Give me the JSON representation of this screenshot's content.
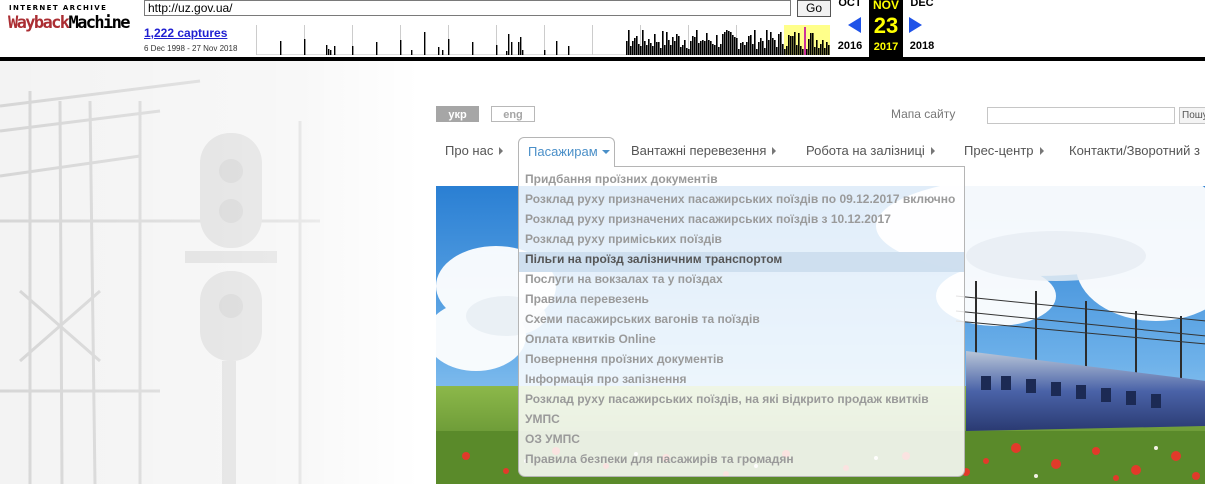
{
  "wayback": {
    "logo_top": "INTERNET ARCHIVE",
    "logo_way": "Wayback",
    "logo_machine": "Machine",
    "url": "http://uz.gov.ua/",
    "go_label": "Go",
    "captures": "1,222 captures",
    "range": "6 Dec 1998 - 27 Nov 2018",
    "prev_month": "OCT",
    "cur_month": "NOV",
    "next_month": "DEC",
    "cur_day": "23",
    "prev_year": "2016",
    "cur_year": "2017",
    "next_year": "2018",
    "colors": {
      "highlight": "#ffff00",
      "arrow": "#1f53e8",
      "logo_red": "#ab2e33"
    }
  },
  "header": {
    "lang_ukr": "укр",
    "lang_eng": "eng",
    "sitemap": "Мапа сайту",
    "search_button": "Пошук"
  },
  "nav": {
    "items": [
      {
        "label": "Про нас"
      },
      {
        "label": "Пасажирам"
      },
      {
        "label": "Вантажні перевезення"
      },
      {
        "label": "Робота на залізниці"
      },
      {
        "label": "Прес-центр"
      },
      {
        "label": "Контакти/Зворотний з"
      }
    ]
  },
  "dropdown": {
    "items": [
      {
        "label": "Придбання проїзних документів"
      },
      {
        "label": "Розклад руху призначених пасажирських поїздів по 09.12.2017 включно"
      },
      {
        "label": "Розклад руху призначених пасажирських поїздів з 10.12.2017"
      },
      {
        "label": "Розклад руху приміських поїздів"
      },
      {
        "label": "Пільги на проїзд залізничним транспортом"
      },
      {
        "label": "Послуги на вокзалах та у поїздах"
      },
      {
        "label": "Правила перевезень"
      },
      {
        "label": "Схеми пасажирських вагонів та поїздів"
      },
      {
        "label": "Оплата квитків Online"
      },
      {
        "label": "Повернення проїзних документів"
      },
      {
        "label": "Інформація про запізнення"
      },
      {
        "label": "Розклад руху пасажирських поїздів, на які відкрито продаж квитків"
      },
      {
        "label": "УМПС"
      },
      {
        "label": "ОЗ УМПС"
      },
      {
        "label": "Правила безпеки для пасажирів та громадян"
      }
    ]
  },
  "colors": {
    "nav_active": "#4a8fc8",
    "dropdown_highlight": "#ccddee"
  }
}
